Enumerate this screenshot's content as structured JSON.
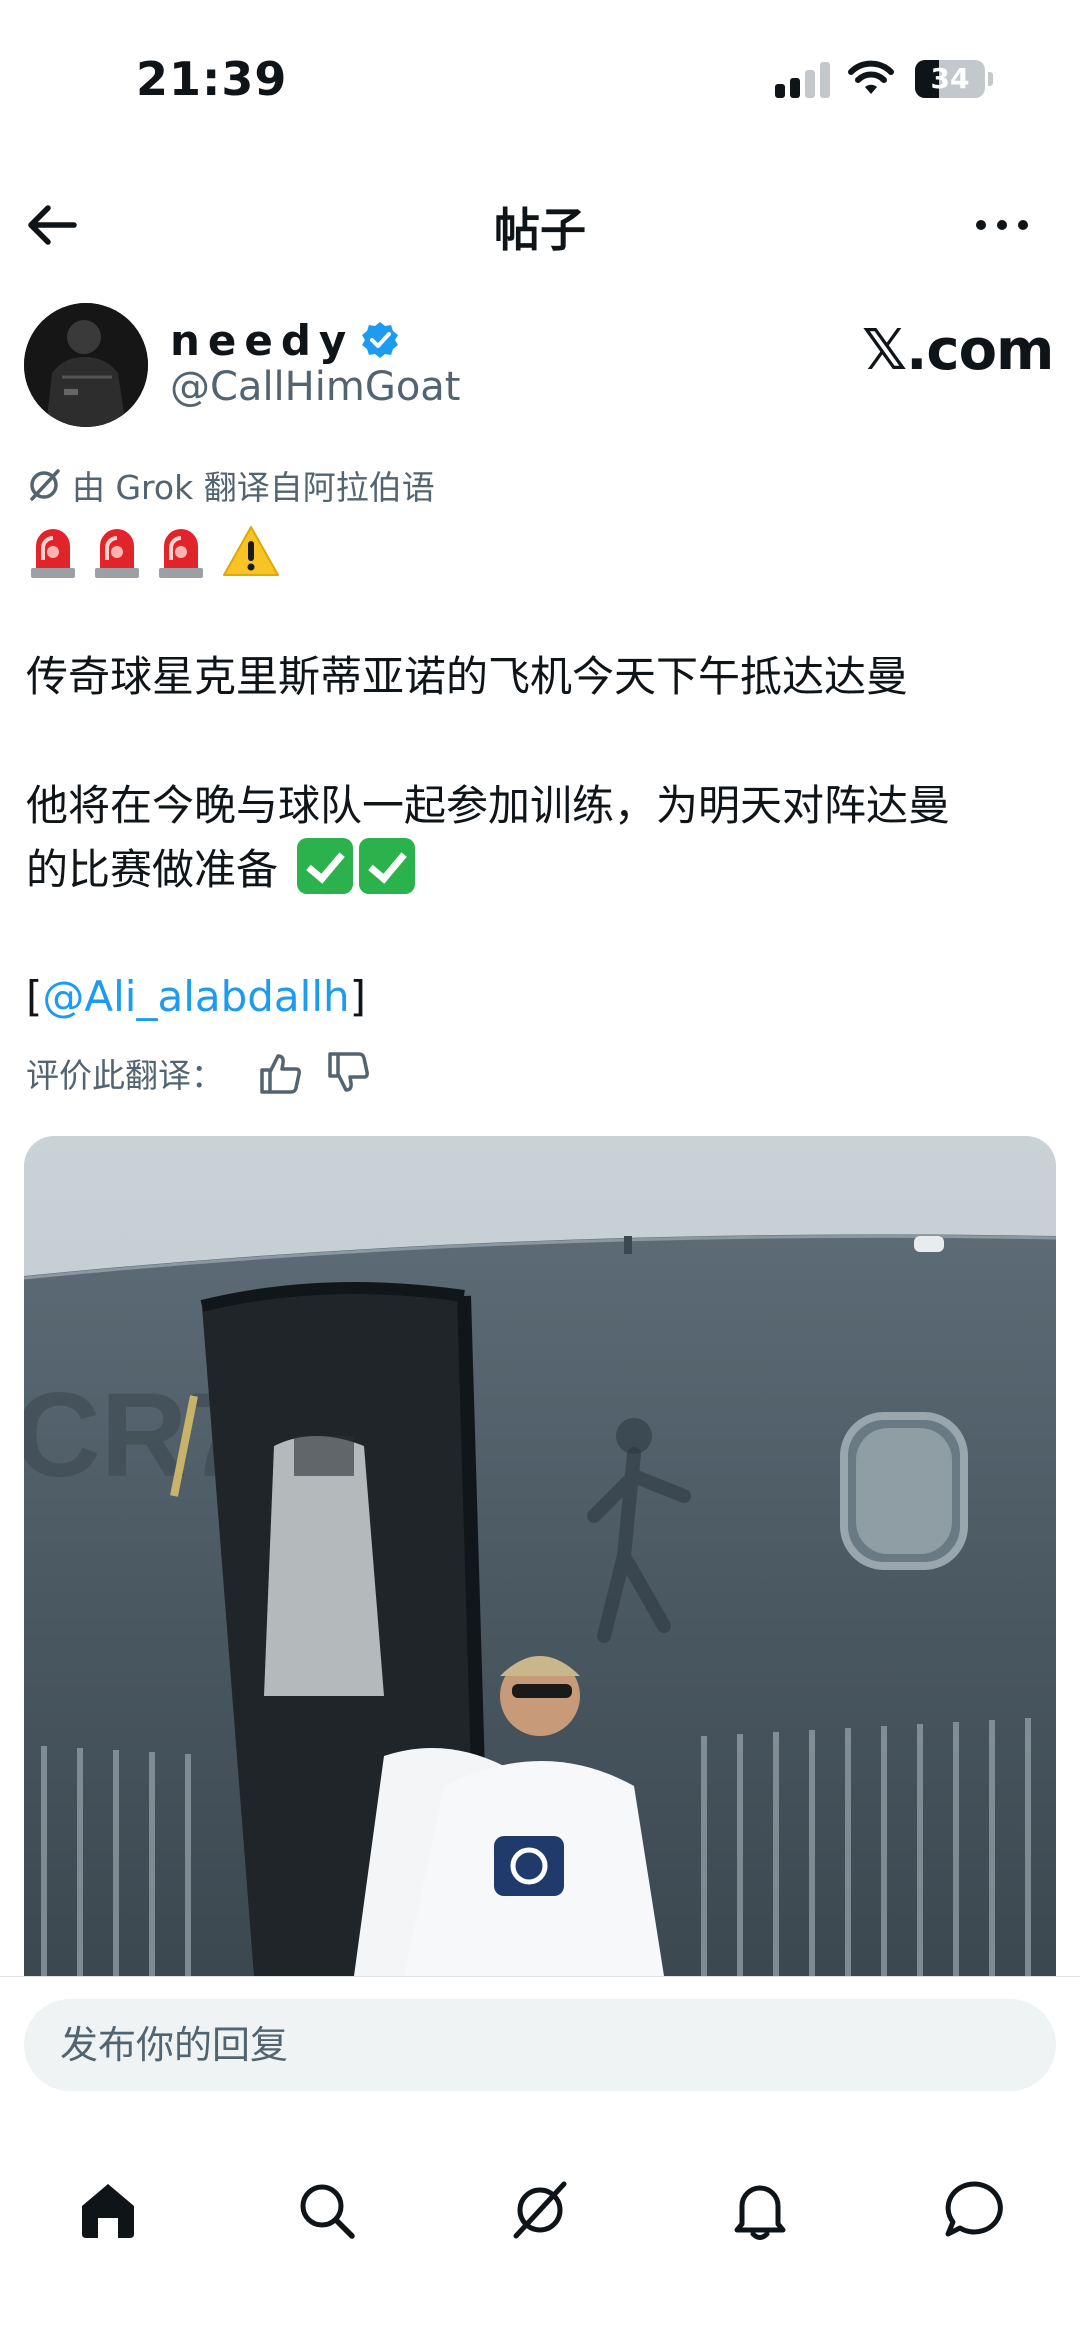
{
  "status_bar": {
    "time": "21:39",
    "battery": "34",
    "battery_level": 0.34
  },
  "header": {
    "title": "帖子"
  },
  "post": {
    "author": {
      "name": "needy",
      "handle": "@CallHimGoat",
      "verified": true
    },
    "source": "𝕏.com",
    "translation_note": "由 Grok 翻译自阿拉伯语",
    "paragraph_1": "传奇球星克里斯蒂亚诺的飞机今天下午抵达达曼",
    "paragraph_2_line_1": "他将在今晚与球队一起参加训练，为明天对阵达曼",
    "paragraph_2_line_2": "的比赛做准备",
    "mention_open": "[",
    "mention": "@Ali_alabdallh",
    "mention_close": "]",
    "rate_translation": "评价此翻译："
  },
  "reply": {
    "placeholder": "发布你的回复"
  },
  "bottom_nav": [
    "home-icon",
    "search-icon",
    "grok-icon",
    "notifications-icon",
    "messages-icon"
  ],
  "colors": {
    "accent": "#1d9bf0",
    "text": "#0f1419",
    "secondary": "#536471",
    "reply_bg": "#eff3f4"
  }
}
